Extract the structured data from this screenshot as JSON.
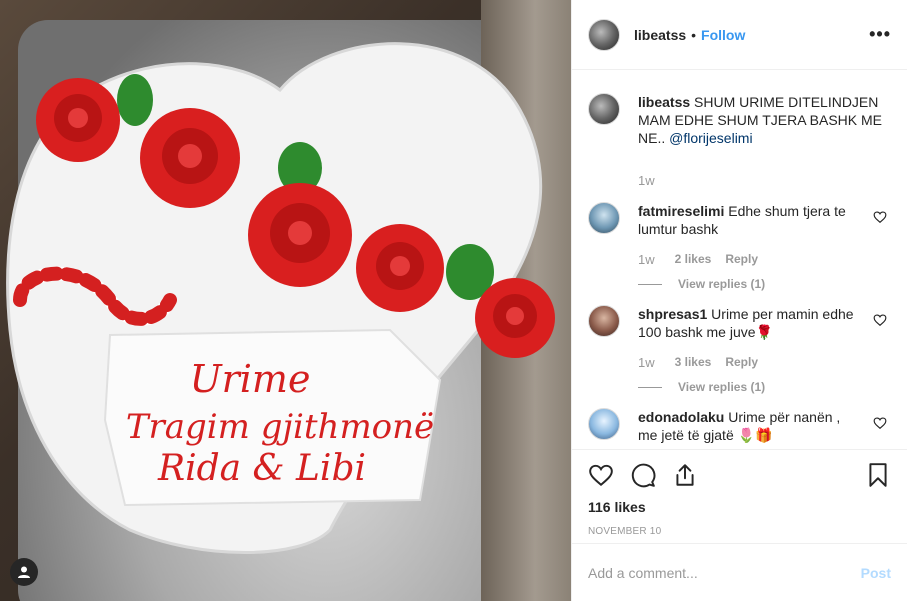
{
  "header": {
    "username": "libeatss",
    "separator": "•",
    "follow_label": "Follow",
    "more_label": "•••"
  },
  "photo": {
    "cake_text": [
      "Urime",
      "Tragim gjithmonë",
      "Rida & Libi"
    ]
  },
  "caption": {
    "username": "libeatss",
    "text": "SHUM URIME DITELINDJEN MAM EDHE SHUM TJERA BASHK ME NE..",
    "mention": "@florijeselimi",
    "time": "1w"
  },
  "comments": [
    {
      "username": "fatmireselimi",
      "text": "Edhe shum tjera te lumtur bashk",
      "time": "1w",
      "likes": "2 likes",
      "reply_label": "Reply",
      "view_replies": "View replies (1)"
    },
    {
      "username": "shpresas1",
      "text": "Urime per mamin edhe 100 bashk me juve🌹",
      "time": "1w",
      "likes": "3 likes",
      "reply_label": "Reply",
      "view_replies": "View replies (1)"
    },
    {
      "username": "edonadolaku",
      "text": "Urime për nanën , me jetë të gjatë 🌷🎁"
    }
  ],
  "actions": {
    "likes": "116 likes",
    "date": "NOVEMBER 10"
  },
  "add_comment": {
    "placeholder": "Add a comment...",
    "post_label": "Post"
  },
  "colors": {
    "link": "#3897f0",
    "post_disabled": "#b3dbff",
    "muted": "#999999",
    "text": "#262626"
  }
}
